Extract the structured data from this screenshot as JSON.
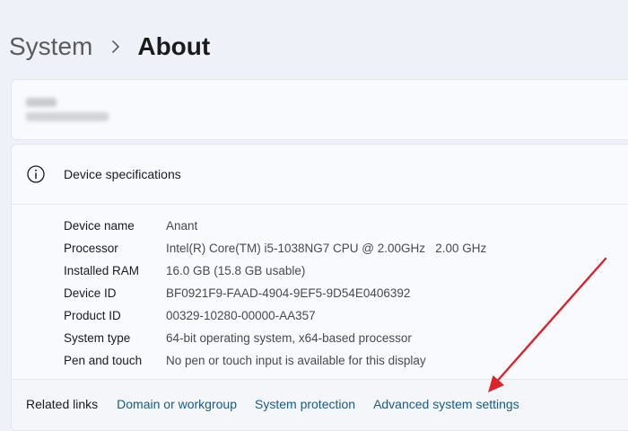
{
  "breadcrumb": {
    "parent": "System",
    "current": "About"
  },
  "specs": {
    "title": "Device specifications",
    "rows": [
      {
        "label": "Device name",
        "value": "Anant"
      },
      {
        "label": "Processor",
        "value": "Intel(R) Core(TM) i5-1038NG7 CPU @ 2.00GHz   2.00 GHz"
      },
      {
        "label": "Installed RAM",
        "value": "16.0 GB (15.8 GB usable)"
      },
      {
        "label": "Device ID",
        "value": "BF0921F9-FAAD-4904-9EF5-9D54E0406392"
      },
      {
        "label": "Product ID",
        "value": "00329-10280-00000-AA357"
      },
      {
        "label": "System type",
        "value": "64-bit operating system, x64-based processor"
      },
      {
        "label": "Pen and touch",
        "value": "No pen or touch input is available for this display"
      }
    ]
  },
  "related": {
    "title": "Related links",
    "links": [
      "Domain or workgroup",
      "System protection",
      "Advanced system settings"
    ]
  },
  "colors": {
    "background": "#eef2f8",
    "card": "#f8fafd",
    "link": "#1c5a86",
    "annotation_arrow": "#d9252b"
  },
  "icons": {
    "separator": "chevron-right-icon",
    "spec_header": "info-icon",
    "annotation": "red-arrow-icon"
  }
}
